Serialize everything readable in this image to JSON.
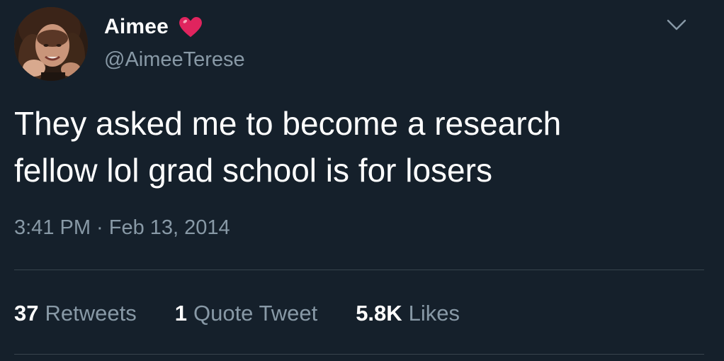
{
  "author": {
    "display_name": "Aimee",
    "handle": "@AimeeTerese",
    "name_emoji": "red-heart-icon"
  },
  "tweet": {
    "text": "They asked me to become a research\nfellow lol grad school is for losers",
    "timestamp": "3:41 PM · Feb 13, 2014"
  },
  "stats": {
    "retweets_count": "37",
    "retweets_label": "Retweets",
    "quotes_count": "1",
    "quotes_label": "Quote Tweet",
    "likes_count": "5.8K",
    "likes_label": "Likes"
  },
  "icons": {
    "more_menu": "chevron-down-icon",
    "avatar": "profile-photo"
  },
  "colors": {
    "background": "#15202b",
    "primary_text": "#ffffff",
    "secondary_text": "#8899a6",
    "divider": "#38444d",
    "heart": "#e0245e"
  }
}
